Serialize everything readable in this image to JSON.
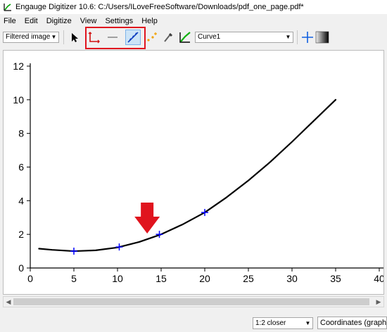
{
  "window": {
    "title": "Engauge Digitizer 10.6: C:/Users/ILoveFreeSoftware/Downloads/pdf_one_page.pdf*"
  },
  "menu": {
    "items": [
      "File",
      "Edit",
      "Digitize",
      "View",
      "Settings",
      "Help"
    ]
  },
  "toolbar": {
    "background_select": "Filtered image",
    "curve_select": "Curve1",
    "tools": [
      "select-arrow-icon",
      "axis-points-icon",
      "scale-bar-icon",
      "curve-points-icon",
      "point-match-icon",
      "color-picker-icon",
      "segment-fill-icon",
      "checklist-guide-icon",
      "checklist-icon"
    ]
  },
  "annotation": {
    "highlight_color": "#e0141e",
    "arrow_color": "#e0141e"
  },
  "chart_data": {
    "type": "line",
    "xlim": [
      0,
      40
    ],
    "ylim": [
      0,
      12
    ],
    "x_ticks": [
      "0",
      "5",
      "10",
      "15",
      "20",
      "25",
      "30",
      "35",
      "40"
    ],
    "y_ticks": [
      "0",
      "2",
      "4",
      "6",
      "8",
      "10",
      "12"
    ],
    "series": [
      {
        "x": [
          1,
          2.5,
          5,
          7.5,
          10,
          12.5,
          15,
          17.5,
          20,
          22.5,
          25,
          27.5,
          30,
          32.5,
          35
        ],
        "y": [
          1.15,
          1.08,
          1.0,
          1.05,
          1.22,
          1.55,
          2.0,
          2.6,
          3.3,
          4.2,
          5.2,
          6.3,
          7.5,
          8.75,
          10.0
        ],
        "color": "#000000"
      }
    ],
    "points": {
      "x": [
        5,
        10.2,
        14.8,
        20
      ],
      "y": [
        1.0,
        1.25,
        2.0,
        3.3
      ],
      "color": "#0000ff"
    },
    "grid": false
  },
  "statusbar": {
    "zoom": "1:2 closer",
    "coordinates_label": "Coordinates (graph):"
  }
}
